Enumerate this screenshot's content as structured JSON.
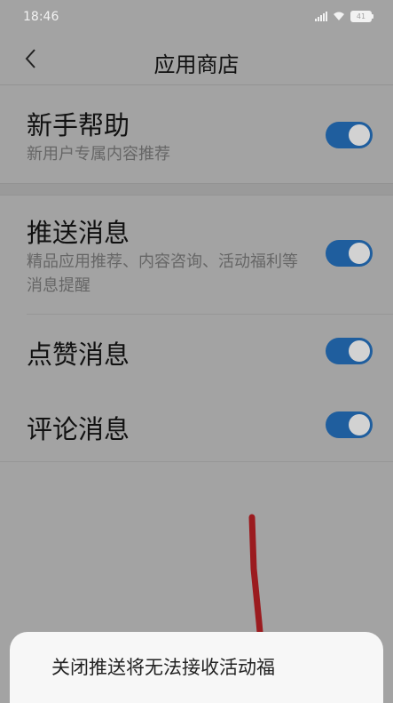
{
  "status": {
    "time": "18:46",
    "battery": "41"
  },
  "header": {
    "title": "应用商店",
    "back_icon": "chevron-left-icon"
  },
  "sections": [
    {
      "items": [
        {
          "title": "新手帮助",
          "subtitle": "新用户专属内容推荐",
          "enabled": true
        }
      ]
    },
    {
      "items": [
        {
          "title": "推送消息",
          "subtitle": "精品应用推荐、内容咨询、活动福利等消息提醒",
          "enabled": true
        },
        {
          "title": "点赞消息",
          "enabled": true
        },
        {
          "title": "评论消息",
          "enabled": true
        }
      ]
    }
  ],
  "dialog": {
    "text": "关闭推送将无法接收活动福"
  },
  "colors": {
    "toggle_on": "#1f5e9e",
    "overlay_bg": "#a3a3a3",
    "annotation": "#9b1b1f"
  }
}
